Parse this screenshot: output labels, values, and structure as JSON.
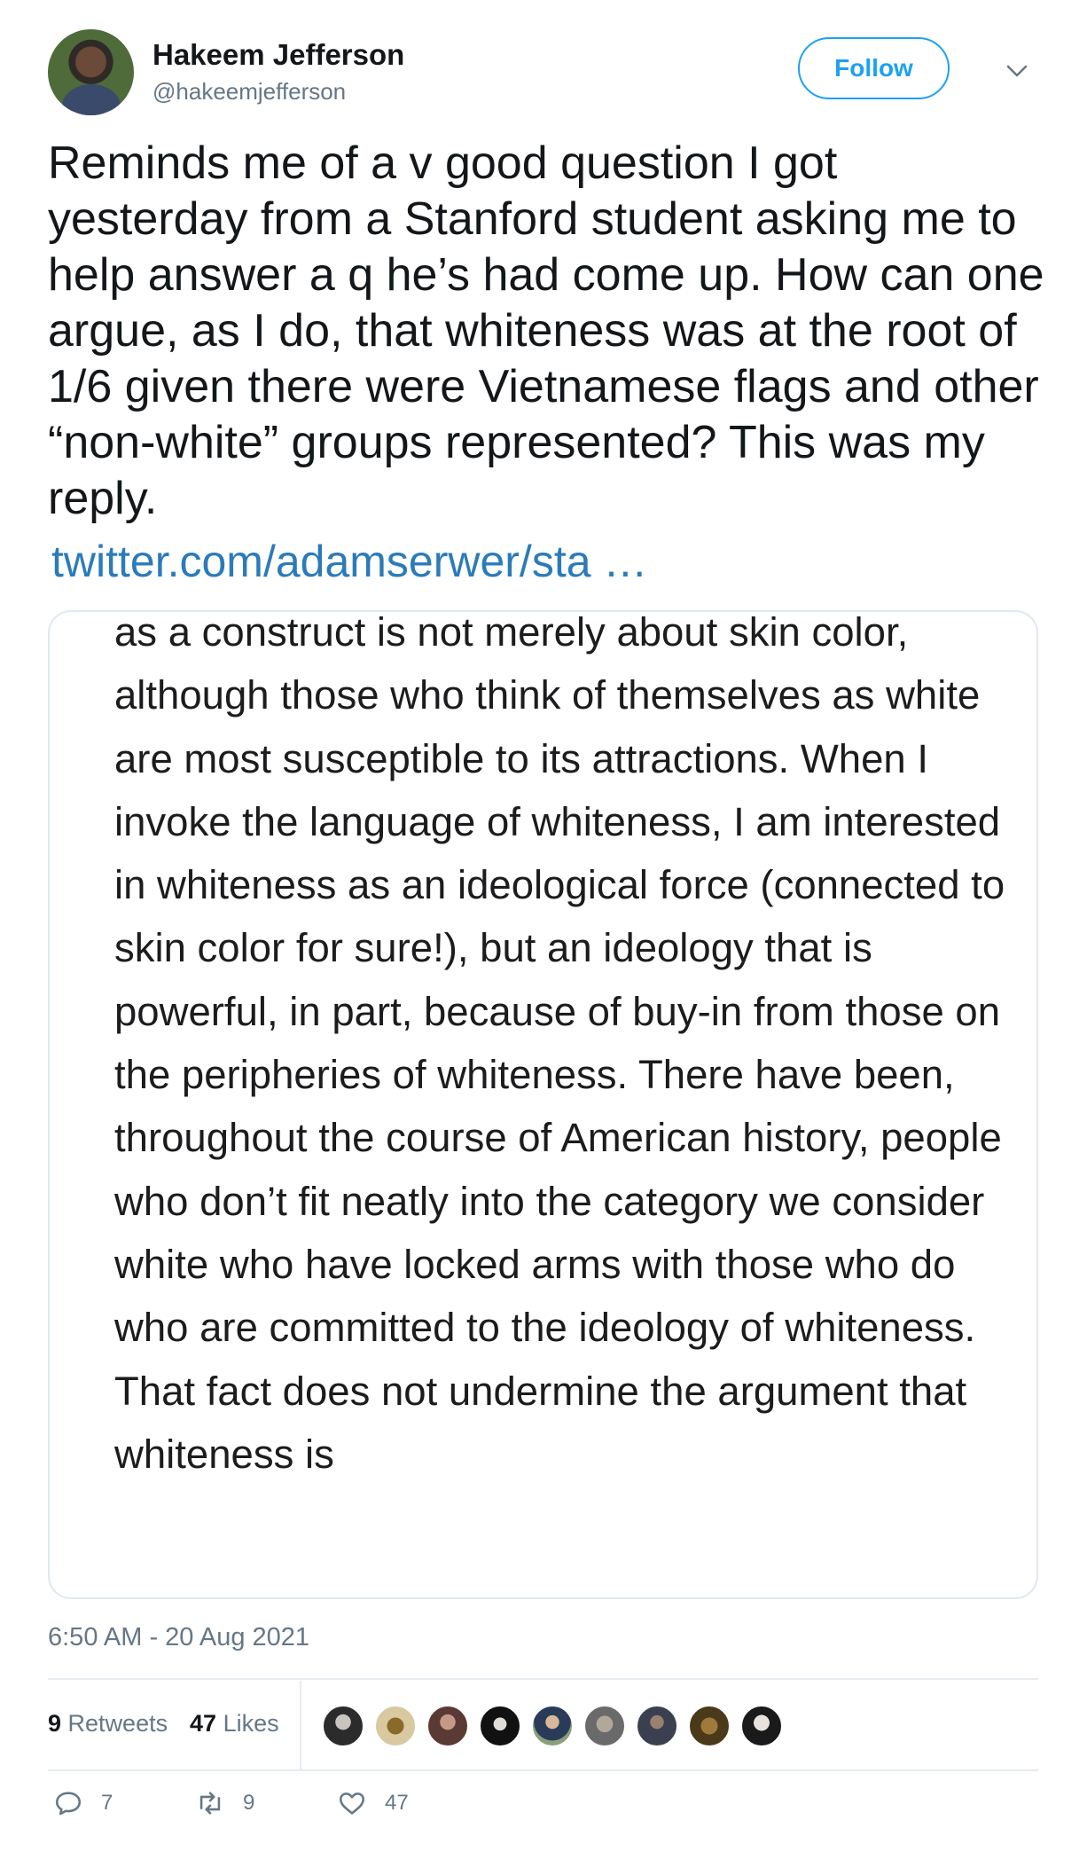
{
  "user": {
    "name": "Hakeem Jefferson",
    "handle": "@hakeemjefferson",
    "follow_label": "Follow"
  },
  "tweet": {
    "text": "Reminds me of a v good question I got yesterday from a Stanford student asking me to help answer a q he’s had come up. How can one argue, as I do, that whiteness was at the root of 1/6 given there were Vietnamese flags and other “non-white” groups represented? This was my reply.",
    "link": "twitter.com/adamserwer/sta …",
    "image_text": "as a construct is not merely about skin color, although those who think of themselves as white are most susceptible to its attractions. When I invoke the language of whiteness, I am interested in whiteness as an ideological force (connected to skin color for sure!), but an ideology that is powerful, in part, because of buy-in from those on the peripheries of whiteness. There have been, throughout the course of American history, people who don’t fit neatly into the category we consider white who have locked arms with those who do who are committed to the ideology of whiteness. That fact does not undermine the argument that whiteness is",
    "timestamp": "6:50 AM - 20 Aug 2021"
  },
  "stats": {
    "retweets_count": "9",
    "retweets_label": "Retweets",
    "likes_count": "47",
    "likes_label": "Likes"
  },
  "actions": {
    "reply_count": "7",
    "retweet_count": "9",
    "like_count": "47"
  },
  "colors": {
    "accent": "#1da1f2",
    "link": "#2b7bb9",
    "muted": "#657786"
  }
}
